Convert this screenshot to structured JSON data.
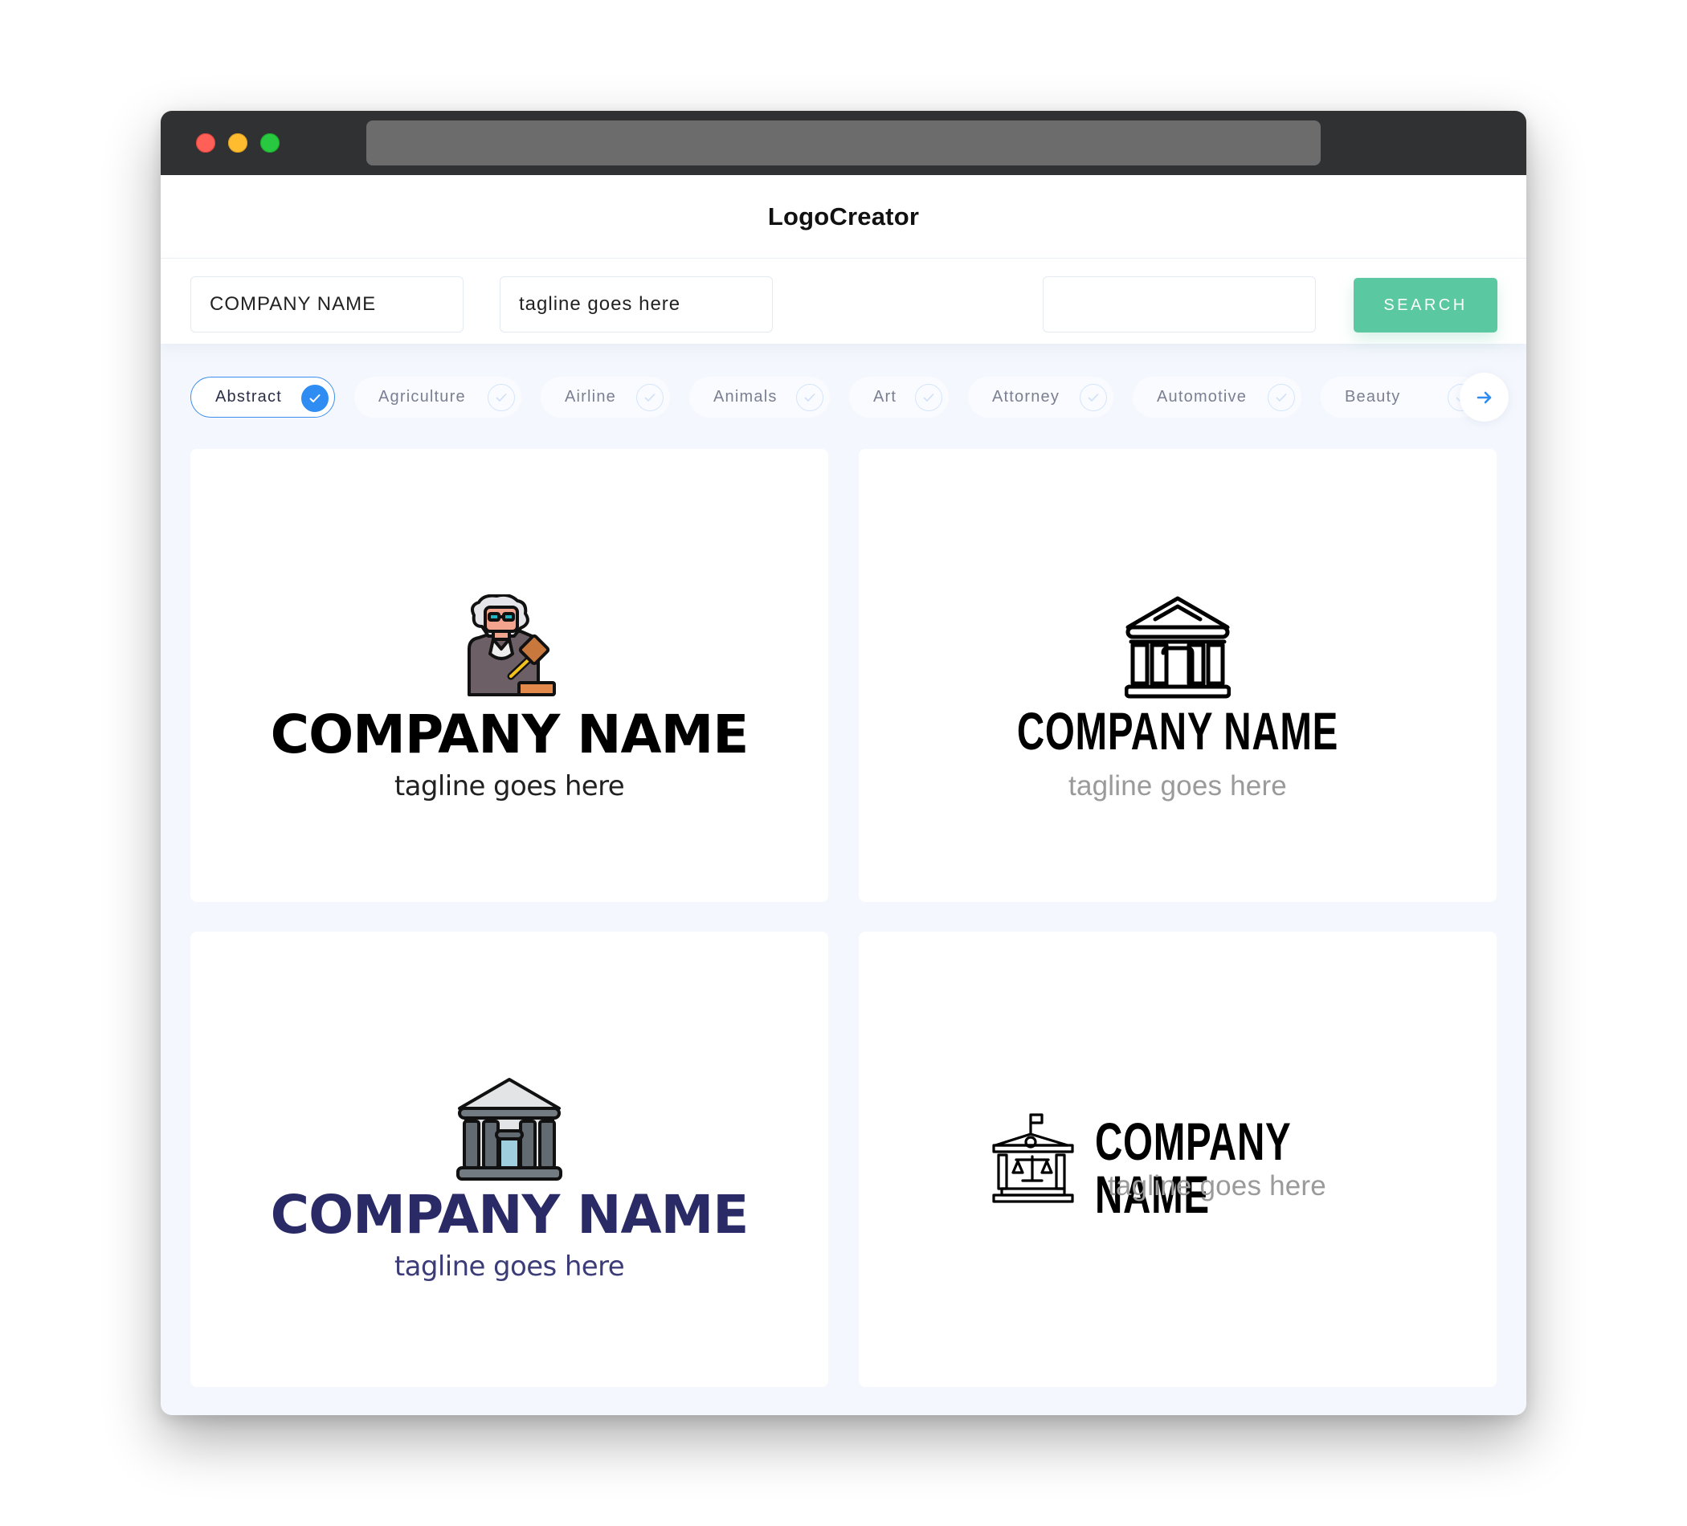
{
  "app": {
    "title": "LogoCreator"
  },
  "search": {
    "company_name_value": "COMPANY NAME",
    "tagline_value": "tagline goes here",
    "query_value": "",
    "button_label": "SEARCH"
  },
  "categories": [
    {
      "label": "Abstract",
      "selected": true
    },
    {
      "label": "Agriculture",
      "selected": false
    },
    {
      "label": "Airline",
      "selected": false
    },
    {
      "label": "Animals",
      "selected": false
    },
    {
      "label": "Art",
      "selected": false
    },
    {
      "label": "Attorney",
      "selected": false
    },
    {
      "label": "Automotive",
      "selected": false
    },
    {
      "label": "Beauty",
      "selected": false
    }
  ],
  "colors": {
    "accent_blue": "#2f8cf3",
    "search_green": "#5ac8a0",
    "navy_name": "#2a2a66"
  },
  "logos": [
    {
      "icon": "judge-with-gavel-icon",
      "company_name": "COMPANY NAME",
      "tagline": "tagline goes here",
      "name_color": "#000000",
      "tagline_color": "#222222"
    },
    {
      "icon": "courthouse-outline-icon",
      "company_name": "COMPANY NAME",
      "tagline": "tagline goes here",
      "name_color": "#000000",
      "tagline_color": "#9a9a9a"
    },
    {
      "icon": "courthouse-filled-icon",
      "company_name": "COMPANY NAME",
      "tagline": "tagline goes here",
      "name_color": "#2a2a66",
      "tagline_color": "#3c3c78"
    },
    {
      "icon": "courthouse-scales-icon",
      "company_name": "COMPANY NAME",
      "tagline": "tagline goes here",
      "name_color": "#000000",
      "tagline_color": "#9a9a9a"
    }
  ]
}
